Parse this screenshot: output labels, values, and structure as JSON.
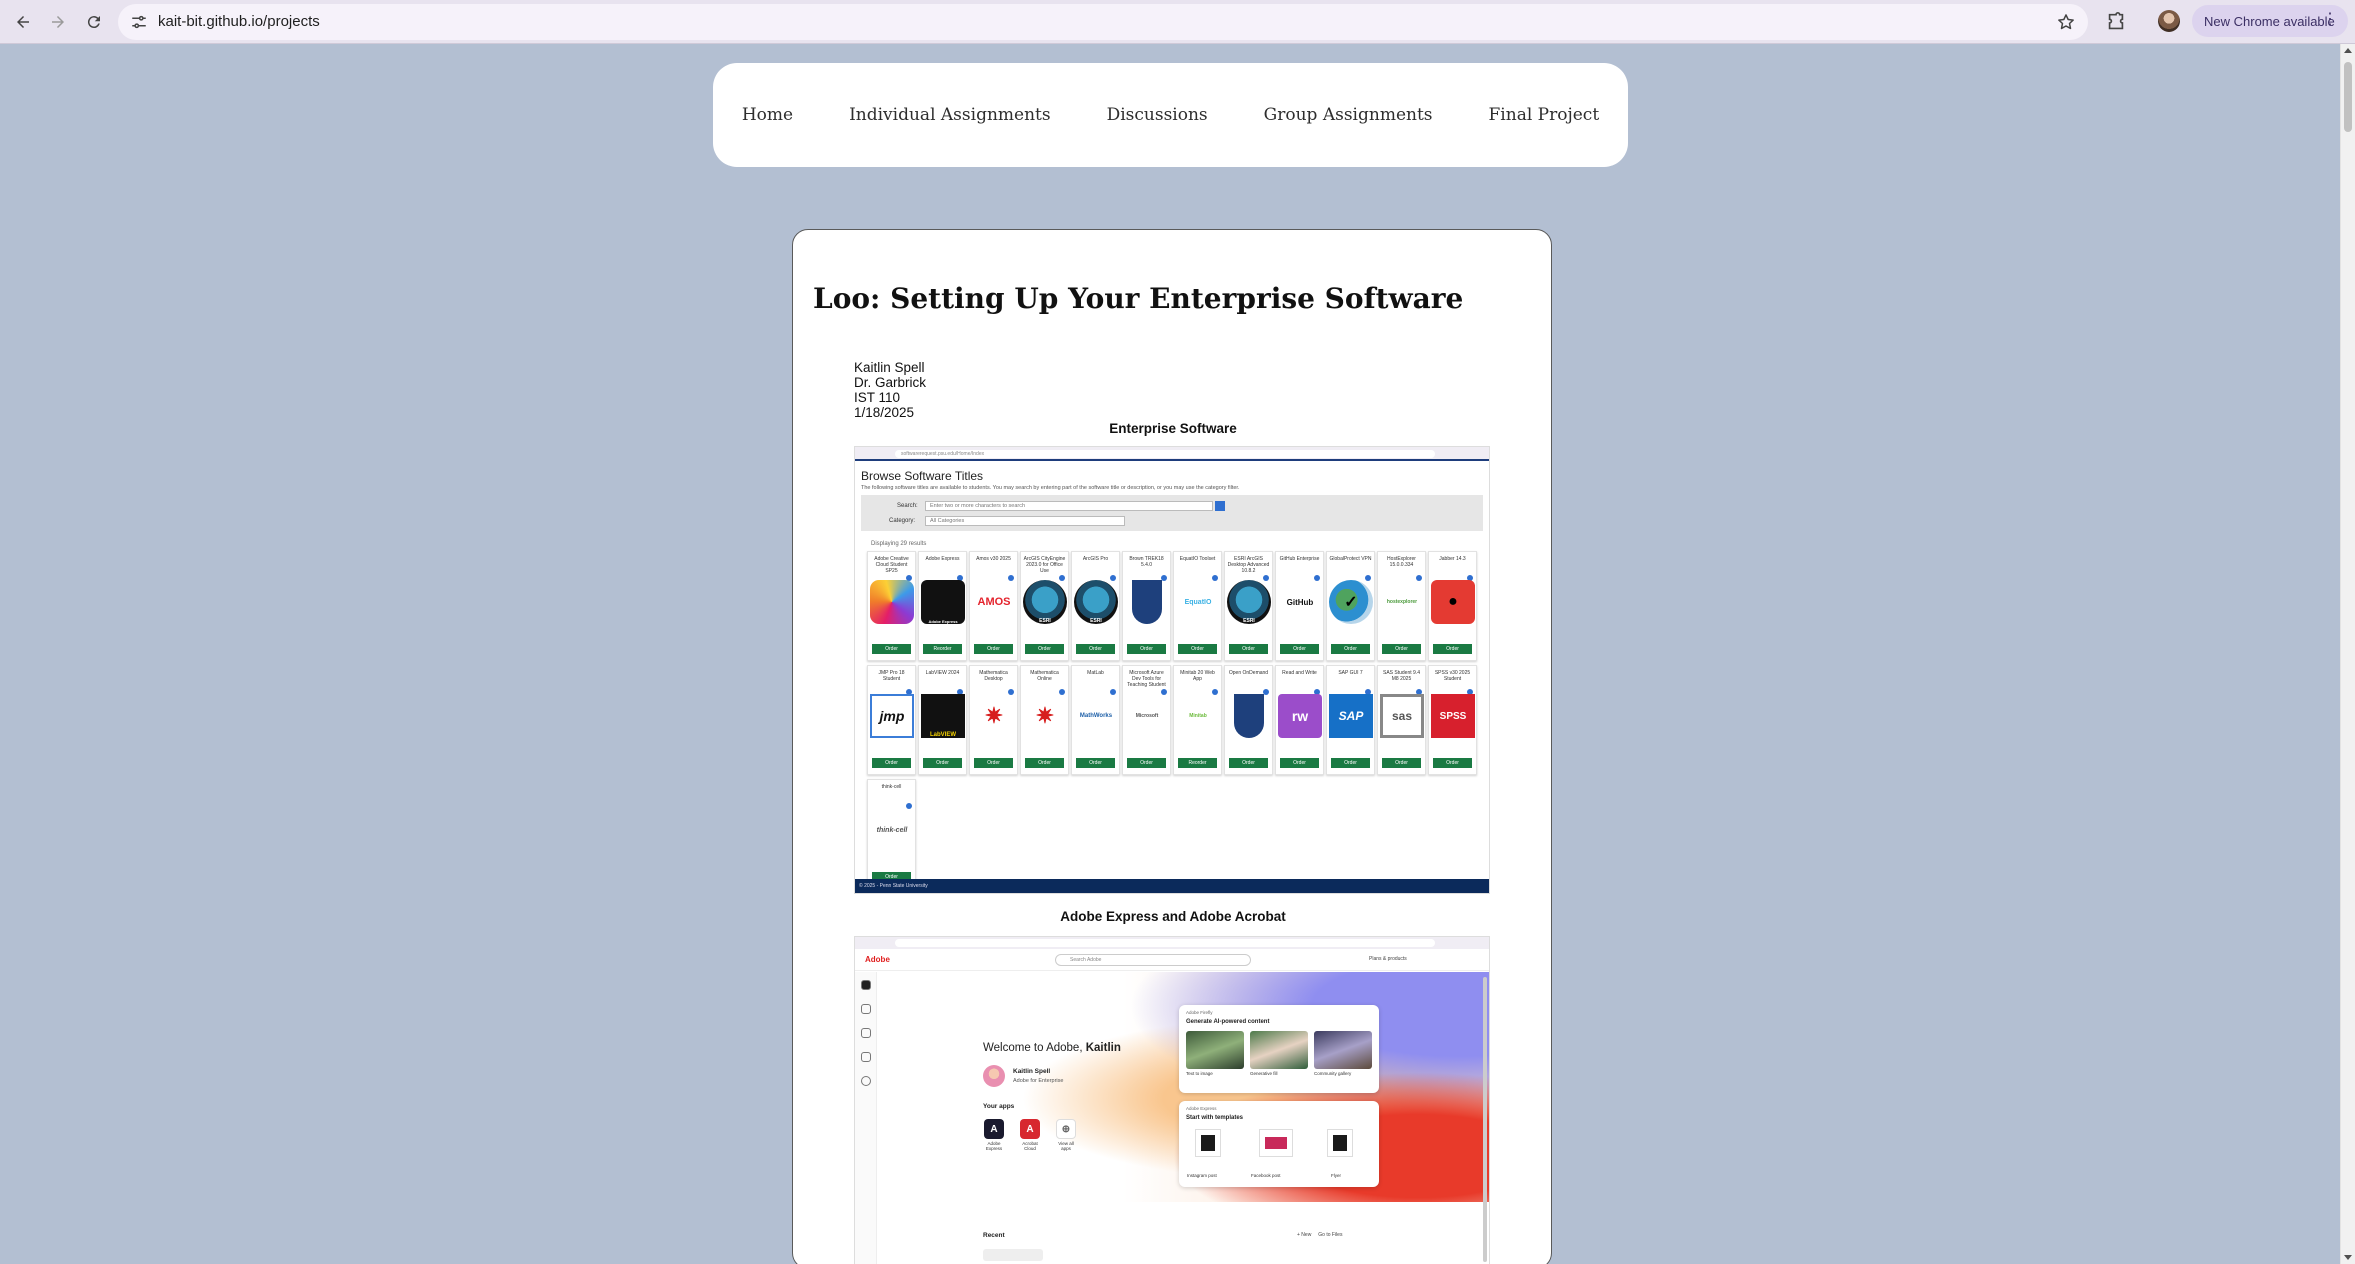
{
  "browser": {
    "url": "kait-bit.github.io/projects",
    "update_label": "New Chrome available"
  },
  "nav": {
    "items": [
      "Home",
      "Individual Assignments",
      "Discussions",
      "Group Assignments",
      "Final Project"
    ]
  },
  "article": {
    "title": "Loo: Setting Up Your Enterprise Software",
    "heading_lines": [
      "Kaitlin Spell",
      "Dr. Garbrick",
      "IST 110",
      "1/18/2025"
    ],
    "section1_title": "Enterprise Software",
    "section2_title": "Adobe Express and Adobe Acrobat"
  },
  "software_catalog": {
    "url": "softwarerequest.psu.edu/Home/Index",
    "title": "Browse Software Titles",
    "description": "The following software titles are available to students. You may search by entering part of the software title or description, or you may use the category filter.",
    "search_label": "Search:",
    "search_placeholder": "Enter two or more characters to search",
    "category_label": "Category:",
    "category_value": "All Categories",
    "results_text": "Displaying 29 results",
    "order_label": "Order",
    "footer": "© 2025 - Penn State University",
    "row1": [
      {
        "name": "Adobe Creative Cloud Student SP25",
        "logo": "adobe-cc"
      },
      {
        "name": "Adobe Express",
        "logo": "adobe-express",
        "button": "Reorder"
      },
      {
        "name": "Amos v30 2025",
        "logo": "amos"
      },
      {
        "name": "ArcGIS CityEngine 2023.0 for Office Use",
        "logo": "esri"
      },
      {
        "name": "ArcGIS Pro",
        "logo": "esri"
      },
      {
        "name": "Brown TREK18 5.4.0",
        "logo": "psu-shield"
      },
      {
        "name": "EquatIO Toolset",
        "logo": "equatio"
      },
      {
        "name": "ESRI ArcGIS Desktop Advanced 10.8.2",
        "logo": "esri"
      },
      {
        "name": "GitHub Enterprise",
        "logo": "github"
      },
      {
        "name": "GlobalProtect VPN",
        "logo": "globalprotect"
      },
      {
        "name": "HostExplorer 15.0.0.334",
        "logo": "hostexplorer"
      },
      {
        "name": "Jabber 14.3",
        "logo": "jabber"
      }
    ],
    "row2": [
      {
        "name": "JMP Pro 18 Student",
        "logo": "jmp"
      },
      {
        "name": "LabVIEW 2024",
        "logo": "labview"
      },
      {
        "name": "Mathematica Desktop",
        "logo": "mathematica"
      },
      {
        "name": "Mathematica Online",
        "logo": "mathematica"
      },
      {
        "name": "MatLab",
        "logo": "mathworks"
      },
      {
        "name": "Microsoft Azure Dev Tools for Teaching Student",
        "logo": "microsoft"
      },
      {
        "name": "Minitab 20 Web App",
        "logo": "minitab",
        "button": "Reorder"
      },
      {
        "name": "Open OnDemand",
        "logo": "psu-shield"
      },
      {
        "name": "Read and Write",
        "logo": "readwrite"
      },
      {
        "name": "SAP GUI 7",
        "logo": "sap"
      },
      {
        "name": "SAS Student 9.4 M8 2025",
        "logo": "sas"
      },
      {
        "name": "SPSS v30 2025 Student",
        "logo": "spss"
      }
    ],
    "row3": [
      {
        "name": "think-cell",
        "logo": "think-cell"
      }
    ],
    "logo_text": {
      "amos": "AMOS",
      "github": "GitHub",
      "jmp": "jmp",
      "labview": "LabVIEW",
      "mathworks": "MathWorks",
      "microsoft": "Microsoft",
      "minitab": "Minitab",
      "readwrite": "rw",
      "sap": "SAP",
      "sas": "sas",
      "spss": "SPSS",
      "think-cell": "think-cell",
      "esri": "ESRI",
      "adobe-express": "Adobe Express",
      "hostexplorer": "hostexplorer",
      "equatio": "EquatIO"
    }
  },
  "adobe": {
    "brand": "Adobe",
    "search_placeholder": "Search Adobe",
    "plans": "Plans & products",
    "welcome_prefix": "Welcome to Adobe,",
    "welcome_name": "Kaitlin",
    "user_name": "Kaitlin Spell",
    "user_org": "Adobe for Enterprise",
    "your_apps": "Your apps",
    "apps": [
      {
        "label": "Adobe Express",
        "color": "#1a1a2e",
        "glyph": "A"
      },
      {
        "label": "Acrobat Cloud",
        "color": "#d7282f",
        "glyph": "A"
      },
      {
        "label": "View all apps",
        "color": "#ffffff",
        "glyph": "⊕"
      }
    ],
    "firefly_tag": "Adobe Firefly",
    "firefly_head": "Generate AI-powered content",
    "firefly_items": [
      "Text to image",
      "Generative fill",
      "Community gallery"
    ],
    "express_tag": "Adobe Express",
    "express_head": "Start with templates",
    "templates": [
      "Instagram post",
      "Facebook post",
      "Flyer"
    ],
    "recent": "Recent",
    "recent_new": "+ New",
    "recent_files": "Go to Files"
  }
}
